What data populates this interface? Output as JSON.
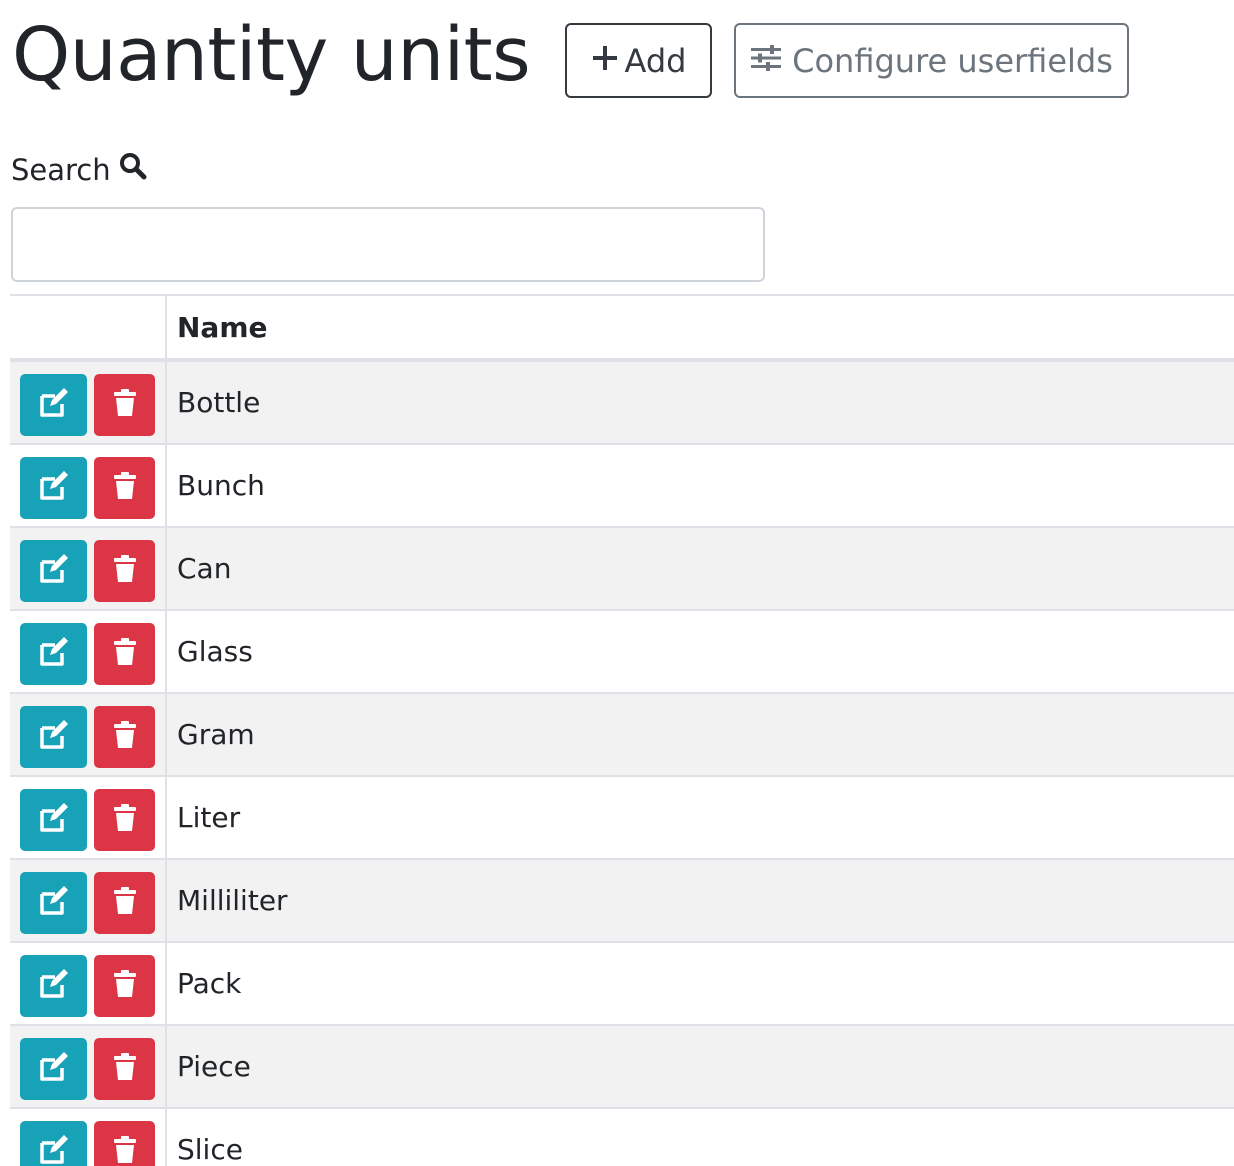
{
  "header": {
    "title": "Quantity units",
    "add_label": "Add",
    "configure_label": "Configure userfields"
  },
  "search": {
    "label": "Search",
    "value": ""
  },
  "table": {
    "columns": [
      "",
      "Name"
    ],
    "rows": [
      {
        "name": "Bottle"
      },
      {
        "name": "Bunch"
      },
      {
        "name": "Can"
      },
      {
        "name": "Glass"
      },
      {
        "name": "Gram"
      },
      {
        "name": "Liter"
      },
      {
        "name": "Milliliter"
      },
      {
        "name": "Pack"
      },
      {
        "name": "Piece"
      },
      {
        "name": "Slice"
      }
    ]
  },
  "icons": {
    "add": "plus-icon",
    "configure": "sliders-icon",
    "search": "search-icon",
    "edit": "edit-icon",
    "delete": "trash-icon"
  },
  "colors": {
    "edit_button": "#17a2b8",
    "delete_button": "#dc3545",
    "row_stripe": "#f2f2f2"
  }
}
